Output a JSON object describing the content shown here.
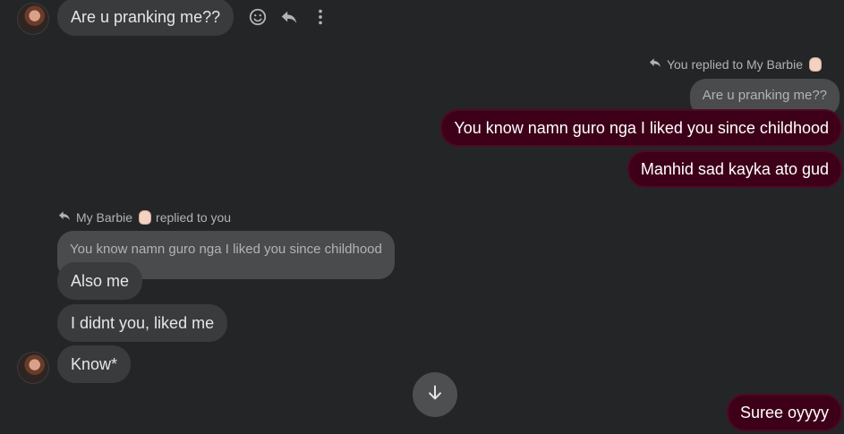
{
  "messages": {
    "top_incoming": "Are u pranking me??",
    "reply_meta_out": "You replied to My Barbie",
    "quote_out": "Are u pranking me??",
    "out_1": "You know namn guro nga I   liked you since childhood",
    "out_2": "Manhid sad kayka ato gud",
    "reply_meta_in": "My Barbie",
    "reply_meta_in_suffix": "replied to you",
    "quote_in": "You know namn guro nga I   liked you since childhood",
    "in_1": "Also me",
    "in_2": "I didnt you, liked me",
    "in_3": "Know*",
    "out_3": "Suree oyyyy"
  },
  "icons": {
    "react": "smiley-icon",
    "reply": "reply-icon",
    "more": "more-vertical-icon",
    "reply_small": "reply-arrow-icon",
    "scroll": "arrow-down-icon",
    "emoji": "pinching-hand-emoji"
  },
  "colors": {
    "background": "#242526",
    "incoming_bubble": "#3a3b3c",
    "outgoing_bubble": "#3d0018",
    "quote_bubble": "#4a4b4c"
  }
}
